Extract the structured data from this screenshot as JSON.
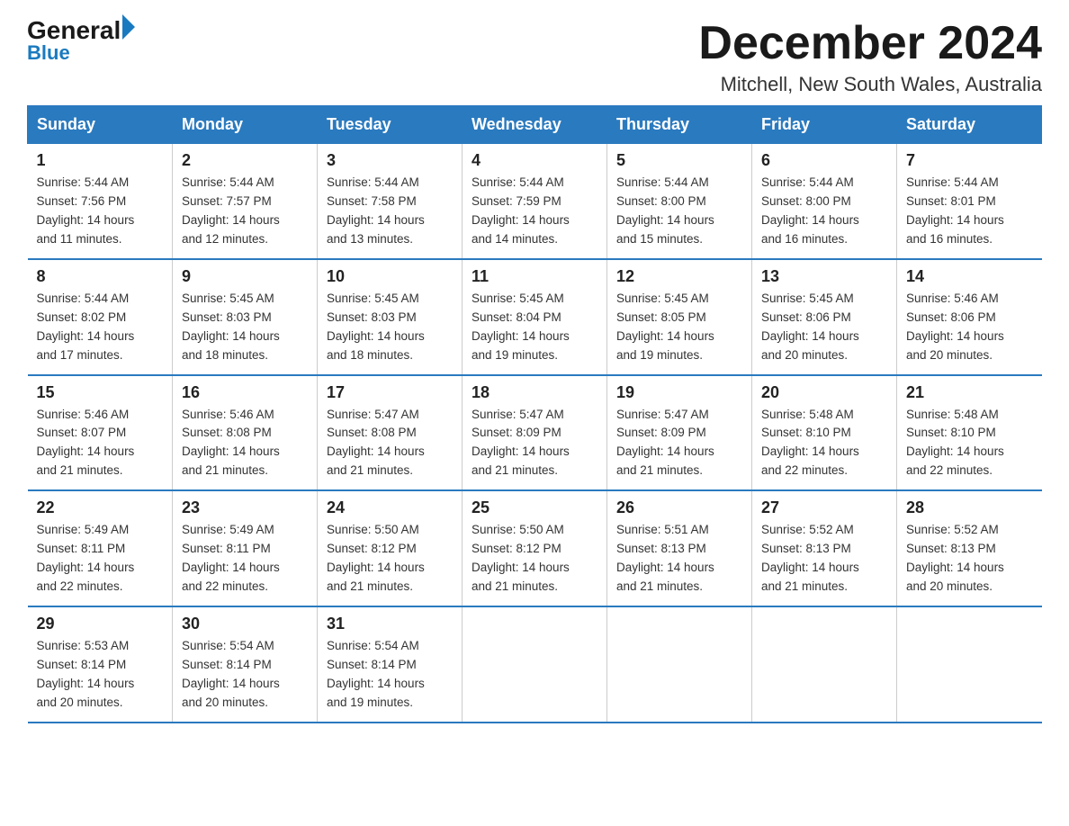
{
  "header": {
    "logo_general": "General",
    "logo_blue": "Blue",
    "title": "December 2024",
    "location": "Mitchell, New South Wales, Australia"
  },
  "days_of_week": [
    "Sunday",
    "Monday",
    "Tuesday",
    "Wednesday",
    "Thursday",
    "Friday",
    "Saturday"
  ],
  "weeks": [
    [
      {
        "day": "1",
        "sunrise": "5:44 AM",
        "sunset": "7:56 PM",
        "daylight": "14 hours and 11 minutes."
      },
      {
        "day": "2",
        "sunrise": "5:44 AM",
        "sunset": "7:57 PM",
        "daylight": "14 hours and 12 minutes."
      },
      {
        "day": "3",
        "sunrise": "5:44 AM",
        "sunset": "7:58 PM",
        "daylight": "14 hours and 13 minutes."
      },
      {
        "day": "4",
        "sunrise": "5:44 AM",
        "sunset": "7:59 PM",
        "daylight": "14 hours and 14 minutes."
      },
      {
        "day": "5",
        "sunrise": "5:44 AM",
        "sunset": "8:00 PM",
        "daylight": "14 hours and 15 minutes."
      },
      {
        "day": "6",
        "sunrise": "5:44 AM",
        "sunset": "8:00 PM",
        "daylight": "14 hours and 16 minutes."
      },
      {
        "day": "7",
        "sunrise": "5:44 AM",
        "sunset": "8:01 PM",
        "daylight": "14 hours and 16 minutes."
      }
    ],
    [
      {
        "day": "8",
        "sunrise": "5:44 AM",
        "sunset": "8:02 PM",
        "daylight": "14 hours and 17 minutes."
      },
      {
        "day": "9",
        "sunrise": "5:45 AM",
        "sunset": "8:03 PM",
        "daylight": "14 hours and 18 minutes."
      },
      {
        "day": "10",
        "sunrise": "5:45 AM",
        "sunset": "8:03 PM",
        "daylight": "14 hours and 18 minutes."
      },
      {
        "day": "11",
        "sunrise": "5:45 AM",
        "sunset": "8:04 PM",
        "daylight": "14 hours and 19 minutes."
      },
      {
        "day": "12",
        "sunrise": "5:45 AM",
        "sunset": "8:05 PM",
        "daylight": "14 hours and 19 minutes."
      },
      {
        "day": "13",
        "sunrise": "5:45 AM",
        "sunset": "8:06 PM",
        "daylight": "14 hours and 20 minutes."
      },
      {
        "day": "14",
        "sunrise": "5:46 AM",
        "sunset": "8:06 PM",
        "daylight": "14 hours and 20 minutes."
      }
    ],
    [
      {
        "day": "15",
        "sunrise": "5:46 AM",
        "sunset": "8:07 PM",
        "daylight": "14 hours and 21 minutes."
      },
      {
        "day": "16",
        "sunrise": "5:46 AM",
        "sunset": "8:08 PM",
        "daylight": "14 hours and 21 minutes."
      },
      {
        "day": "17",
        "sunrise": "5:47 AM",
        "sunset": "8:08 PM",
        "daylight": "14 hours and 21 minutes."
      },
      {
        "day": "18",
        "sunrise": "5:47 AM",
        "sunset": "8:09 PM",
        "daylight": "14 hours and 21 minutes."
      },
      {
        "day": "19",
        "sunrise": "5:47 AM",
        "sunset": "8:09 PM",
        "daylight": "14 hours and 21 minutes."
      },
      {
        "day": "20",
        "sunrise": "5:48 AM",
        "sunset": "8:10 PM",
        "daylight": "14 hours and 22 minutes."
      },
      {
        "day": "21",
        "sunrise": "5:48 AM",
        "sunset": "8:10 PM",
        "daylight": "14 hours and 22 minutes."
      }
    ],
    [
      {
        "day": "22",
        "sunrise": "5:49 AM",
        "sunset": "8:11 PM",
        "daylight": "14 hours and 22 minutes."
      },
      {
        "day": "23",
        "sunrise": "5:49 AM",
        "sunset": "8:11 PM",
        "daylight": "14 hours and 22 minutes."
      },
      {
        "day": "24",
        "sunrise": "5:50 AM",
        "sunset": "8:12 PM",
        "daylight": "14 hours and 21 minutes."
      },
      {
        "day": "25",
        "sunrise": "5:50 AM",
        "sunset": "8:12 PM",
        "daylight": "14 hours and 21 minutes."
      },
      {
        "day": "26",
        "sunrise": "5:51 AM",
        "sunset": "8:13 PM",
        "daylight": "14 hours and 21 minutes."
      },
      {
        "day": "27",
        "sunrise": "5:52 AM",
        "sunset": "8:13 PM",
        "daylight": "14 hours and 21 minutes."
      },
      {
        "day": "28",
        "sunrise": "5:52 AM",
        "sunset": "8:13 PM",
        "daylight": "14 hours and 20 minutes."
      }
    ],
    [
      {
        "day": "29",
        "sunrise": "5:53 AM",
        "sunset": "8:14 PM",
        "daylight": "14 hours and 20 minutes."
      },
      {
        "day": "30",
        "sunrise": "5:54 AM",
        "sunset": "8:14 PM",
        "daylight": "14 hours and 20 minutes."
      },
      {
        "day": "31",
        "sunrise": "5:54 AM",
        "sunset": "8:14 PM",
        "daylight": "14 hours and 19 minutes."
      },
      null,
      null,
      null,
      null
    ]
  ],
  "labels": {
    "sunrise": "Sunrise:",
    "sunset": "Sunset:",
    "daylight": "Daylight:"
  }
}
